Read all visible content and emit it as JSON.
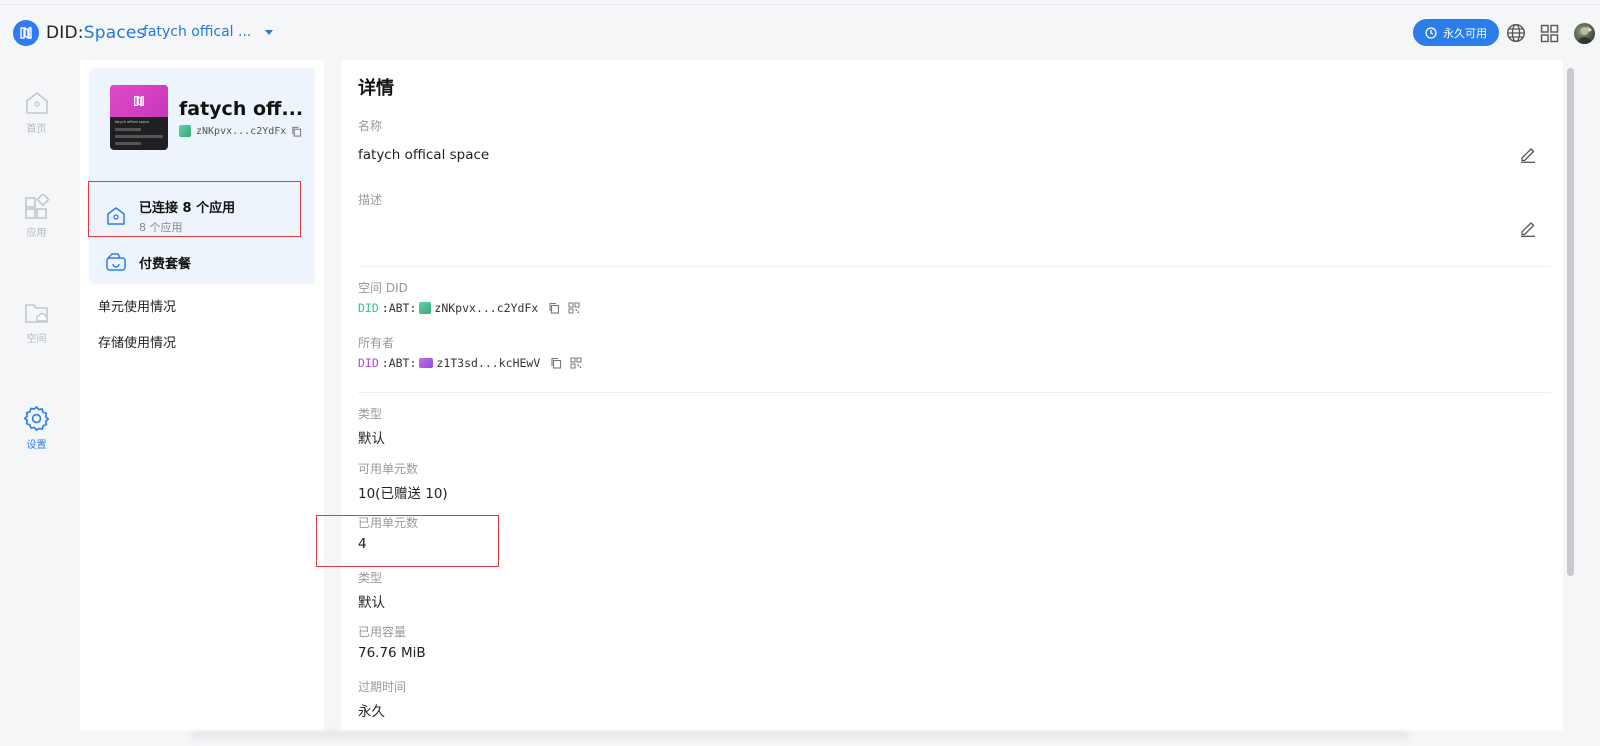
{
  "header": {
    "logo_prefix": "DID",
    "logo_colon": ":",
    "logo_suffix": "Spaces",
    "space_selector": "fatych offical ...",
    "plan_badge": "永久可用"
  },
  "rail": {
    "items": [
      {
        "label": "首页",
        "icon": "home-icon"
      },
      {
        "label": "应用",
        "icon": "apps-icon"
      },
      {
        "label": "空间",
        "icon": "folder-cloud-icon"
      },
      {
        "label": "设置",
        "icon": "gear-icon",
        "active": true
      }
    ]
  },
  "space_card": {
    "title": "fatych off...",
    "did_short": "zNKpvx...c2YdFx",
    "thumb_name": "fatych offical space"
  },
  "subnav": {
    "connected_title": "已连接 8 个应用",
    "connected_sub": "8 个应用",
    "paid_plan": "付费套餐",
    "unit_usage": "单元使用情况",
    "storage_usage": "存储使用情况"
  },
  "details": {
    "title": "详情",
    "name_label": "名称",
    "name_value": "fatych offical space",
    "desc_label": "描述",
    "space_did_label": "空间 DID",
    "space_did_prefix": "DID",
    "space_did_abt": ":ABT:",
    "space_did_value": "zNKpvx...c2YdFx",
    "owner_label": "所有者",
    "owner_did_prefix": "DID",
    "owner_did_abt": ":ABT:",
    "owner_did_value": "z1T3sd...kcHEwV",
    "type_label": "类型",
    "type_value": "默认",
    "avail_units_label": "可用单元数",
    "avail_units_value": "10(已赠送 10)",
    "used_units_label": "已用单元数",
    "used_units_value": "4",
    "type2_label": "类型",
    "type2_value": "默认",
    "used_capacity_label": "已用容量",
    "used_capacity_value": "76.76 MiB",
    "expiry_label": "过期时间",
    "expiry_value": "永久"
  },
  "colors": {
    "accent": "#2b7de9",
    "highlight": "#e0393e"
  }
}
